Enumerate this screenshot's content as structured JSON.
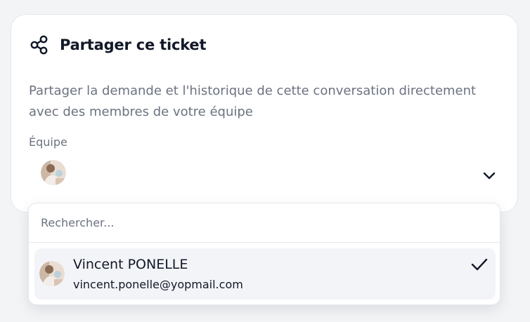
{
  "card": {
    "title": "Partager ce ticket",
    "description": "Partager la demande et l'historique de cette conversation directement avec des membres de votre équipe",
    "share_icon": "share-icon"
  },
  "team_select": {
    "label": "Équipe",
    "selected_avatar": "avatar",
    "toggle_icon": "chevron-down-icon"
  },
  "dropdown": {
    "search_placeholder": "Rechercher...",
    "options": [
      {
        "name": "Vincent PONELLE",
        "email": "vincent.ponelle@yopmail.com",
        "selected": true,
        "selected_icon": "check-icon"
      }
    ]
  }
}
